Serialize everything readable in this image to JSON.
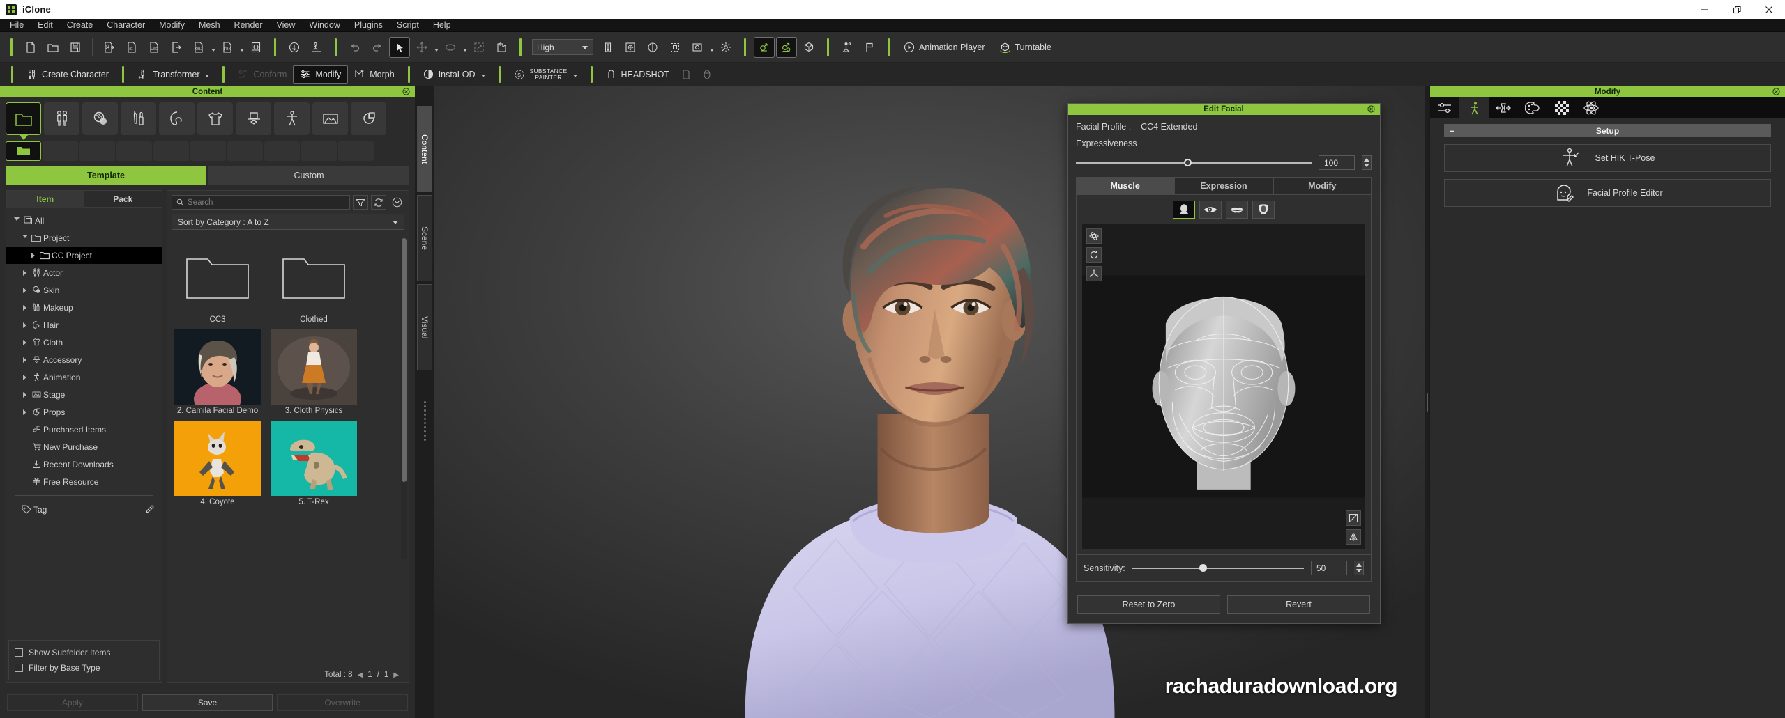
{
  "window": {
    "title": "iClone",
    "minimize": "—",
    "maximize": "❐",
    "close": "✕"
  },
  "menubar": {
    "items": [
      {
        "label": "File"
      },
      {
        "label": "Edit"
      },
      {
        "label": "Create"
      },
      {
        "label": "Character"
      },
      {
        "label": "Modify"
      },
      {
        "label": "Mesh"
      },
      {
        "label": "Render"
      },
      {
        "label": "View"
      },
      {
        "label": "Window"
      },
      {
        "label": "Plugins"
      },
      {
        "label": "Script"
      },
      {
        "label": "Help"
      }
    ]
  },
  "toolbar1": {
    "quality_value": "High",
    "animation_player_label": "Animation Player",
    "turntable_label": "Turntable",
    "icons": [
      "new-project-icon",
      "open-project-icon",
      "save-project-icon",
      "import-character-icon",
      "import-iclone-icon",
      "import-usd-icon",
      "export-icon",
      "export-obj-icon",
      "export-fbx-icon",
      "batch-export-icon",
      "load-motion-icon",
      "save-motion-icon",
      "undo-icon",
      "redo-icon",
      "select-tool-icon",
      "move-tool-icon",
      "rotate-tool-icon",
      "scale-tool-icon",
      "reset-transform-icon",
      "move-axis-icon",
      "fit-view-icon",
      "orbit-icon",
      "bounding-box-icon",
      "snapshot-icon",
      "light-icon",
      "bone-edit-icon",
      "bone-attach-icon",
      "cube-group-icon",
      "spotlight-icon",
      "flag-icon"
    ]
  },
  "toolbar2": {
    "items": [
      {
        "label": "Create Character",
        "name": "create-character-button",
        "state": "normal"
      },
      {
        "label": "Transformer",
        "name": "transformer-button",
        "state": "normal",
        "caret": true
      },
      {
        "label": "Conform",
        "name": "conform-button",
        "state": "disabled"
      },
      {
        "label": "Modify",
        "name": "modify-button",
        "state": "selected"
      },
      {
        "label": "Morph",
        "name": "morph-button",
        "state": "normal"
      },
      {
        "label": "InstaLOD",
        "name": "instalod-button",
        "state": "normal",
        "caret": true
      },
      {
        "label": "SUBSTANCE PAINTER",
        "name": "substance-painter-button",
        "state": "normal",
        "caret": true
      },
      {
        "label": "HEADSHOT",
        "name": "headshot-button",
        "state": "normal"
      }
    ]
  },
  "content_panel": {
    "title": "Content",
    "categories": [
      {
        "name": "project-folder-icon",
        "active": true
      },
      {
        "name": "actor-icon",
        "active": false
      },
      {
        "name": "skin-icon",
        "active": false
      },
      {
        "name": "makeup-icon",
        "active": false
      },
      {
        "name": "hair-icon",
        "active": false
      },
      {
        "name": "cloth-icon",
        "active": false
      },
      {
        "name": "accessory-icon",
        "active": false
      },
      {
        "name": "animation-icon",
        "active": false
      },
      {
        "name": "stage-icon",
        "active": false
      },
      {
        "name": "props-icon",
        "active": false
      }
    ],
    "tabs": {
      "template": "Template",
      "custom": "Custom",
      "active": "Template"
    },
    "item_pack_tabs": {
      "item": "Item",
      "pack": "Pack",
      "active": "Item"
    },
    "tree": [
      {
        "label": "All",
        "depth": 0,
        "arrow": "open",
        "icon": "all-icon",
        "selected": false
      },
      {
        "label": "Project",
        "depth": 1,
        "arrow": "open",
        "icon": "folder-icon",
        "selected": false
      },
      {
        "label": "CC Project",
        "depth": 2,
        "arrow": "closed",
        "icon": "folder-icon",
        "selected": true
      },
      {
        "label": "Actor",
        "depth": 1,
        "arrow": "closed",
        "icon": "actor-icon",
        "selected": false
      },
      {
        "label": "Skin",
        "depth": 1,
        "arrow": "closed",
        "icon": "skin-icon",
        "selected": false
      },
      {
        "label": "Makeup",
        "depth": 1,
        "arrow": "closed",
        "icon": "makeup-icon",
        "selected": false
      },
      {
        "label": "Hair",
        "depth": 1,
        "arrow": "closed",
        "icon": "hair-icon",
        "selected": false
      },
      {
        "label": "Cloth",
        "depth": 1,
        "arrow": "closed",
        "icon": "cloth-icon",
        "selected": false
      },
      {
        "label": "Accessory",
        "depth": 1,
        "arrow": "closed",
        "icon": "accessory-icon",
        "selected": false
      },
      {
        "label": "Animation",
        "depth": 1,
        "arrow": "closed",
        "icon": "animation-icon",
        "selected": false
      },
      {
        "label": "Stage",
        "depth": 1,
        "arrow": "closed",
        "icon": "stage-icon",
        "selected": false
      },
      {
        "label": "Props",
        "depth": 1,
        "arrow": "closed",
        "icon": "props-icon",
        "selected": false
      },
      {
        "label": "Purchased Items",
        "depth": 1,
        "arrow": "none",
        "icon": "purchased-icon",
        "selected": false
      },
      {
        "label": "New Purchase",
        "depth": 1,
        "arrow": "none",
        "icon": "cart-icon",
        "selected": false
      },
      {
        "label": "Recent Downloads",
        "depth": 1,
        "arrow": "none",
        "icon": "download-icon",
        "selected": false
      },
      {
        "label": "Free Resource",
        "depth": 1,
        "arrow": "none",
        "icon": "gift-icon",
        "selected": false
      }
    ],
    "tag_label": "Tag",
    "options": [
      {
        "label": "Show Subfolder Items",
        "checked": false
      },
      {
        "label": "Filter by Base Type",
        "checked": false
      }
    ],
    "search": {
      "placeholder": "Search",
      "value": ""
    },
    "sort": {
      "value": "Sort by Category : A to Z"
    },
    "thumbnails": [
      {
        "label": "CC3",
        "type": "folder"
      },
      {
        "label": "Clothed",
        "type": "folder"
      },
      {
        "label": "2. Camila Facial Demo",
        "type": "portrait"
      },
      {
        "label": "3. Cloth Physics",
        "type": "figure"
      },
      {
        "label": "4. Coyote",
        "type": "coyote",
        "bg": "#f3a009"
      },
      {
        "label": "5. T-Rex",
        "type": "trex",
        "bg": "#15b8a6"
      }
    ],
    "footer": {
      "total": "Total : 8",
      "page_current": "1",
      "separator": "/",
      "page_total": "1"
    },
    "actions": [
      {
        "label": "Apply",
        "state": "disabled"
      },
      {
        "label": "Save",
        "state": "normal"
      },
      {
        "label": "Overwrite",
        "state": "disabled"
      }
    ]
  },
  "vertical_tabs": [
    {
      "label": "Content",
      "active": true
    },
    {
      "label": "Scene",
      "active": false
    },
    {
      "label": "Visual",
      "active": false
    }
  ],
  "viewport": {
    "watermark": "rachaduradownload.org"
  },
  "edit_facial": {
    "title": "Edit Facial",
    "profile_label": "Facial Profile :",
    "profile_value": "CC4 Extended",
    "expressiveness_label": "Expressiveness",
    "expressiveness_value": "100",
    "tabs": [
      {
        "label": "Muscle",
        "active": true
      },
      {
        "label": "Expression",
        "active": false
      },
      {
        "label": "Modify",
        "active": false
      }
    ],
    "region_icons": [
      {
        "name": "head-region-icon",
        "active": true
      },
      {
        "name": "eye-region-icon",
        "active": false
      },
      {
        "name": "mouth-region-icon",
        "active": false
      },
      {
        "name": "tongue-region-icon",
        "active": false
      }
    ],
    "view_tools": [
      "orbit-icon",
      "reset-rotation-icon",
      "axis-icon"
    ],
    "view_tools_br": [
      "paint-mask-icon",
      "mirror-icon"
    ],
    "sensitivity_label": "Sensitivity:",
    "sensitivity_value": "50",
    "buttons": [
      {
        "label": "Reset to Zero"
      },
      {
        "label": "Revert"
      }
    ]
  },
  "modify_panel": {
    "title": "Modify",
    "tabs": [
      {
        "name": "attribute-tab-icon",
        "active": true
      },
      {
        "name": "animation-tab-icon",
        "active": false,
        "green": true
      },
      {
        "name": "transform-tab-icon",
        "active": false
      },
      {
        "name": "material-tab-icon",
        "active": false
      },
      {
        "name": "texture-tab-icon",
        "active": false
      },
      {
        "name": "physics-tab-icon",
        "active": false
      }
    ],
    "section_title": "Setup",
    "collapse_glyph": "–",
    "buttons": [
      {
        "label": "Set HIK T-Pose",
        "icon": "t-pose-icon"
      },
      {
        "label": "Facial Profile Editor",
        "icon": "facial-profile-icon"
      }
    ]
  }
}
